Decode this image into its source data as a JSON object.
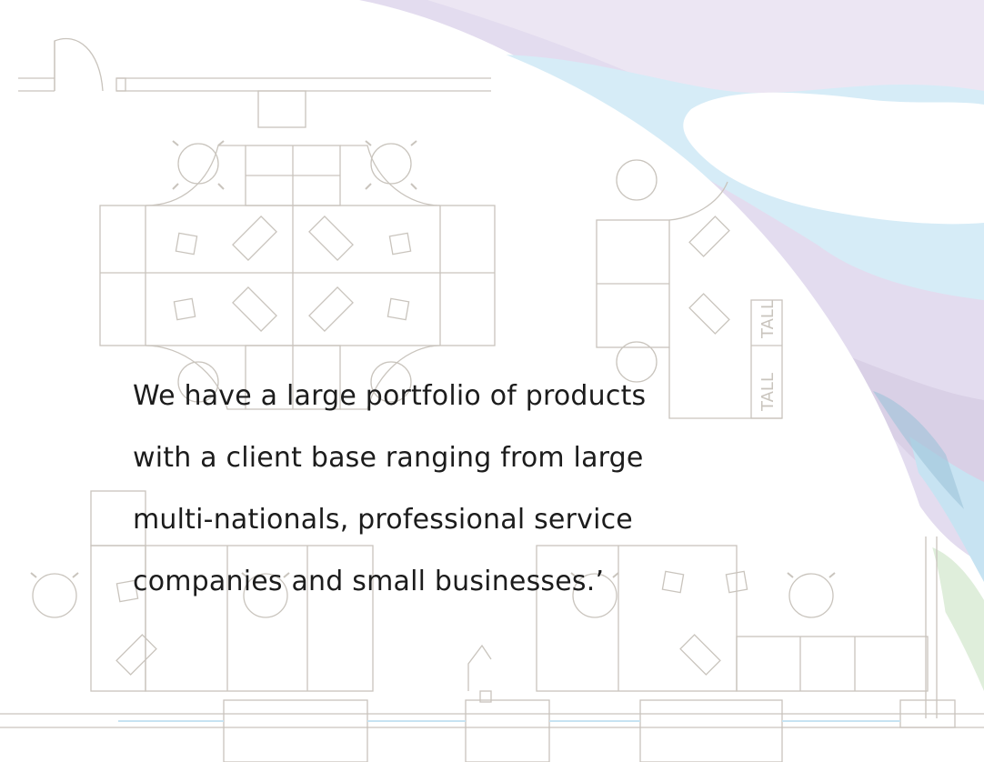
{
  "quote": {
    "lines": [
      "We have a large portfolio of products",
      "with a client base ranging from large",
      "multi-nationals, professional service",
      "companies and small businesses.’"
    ]
  },
  "floorplan": {
    "labels": [
      "TALL",
      "TALL"
    ]
  },
  "colors": {
    "floorplan_line": "#c9c4bd",
    "sky_light": "#dbeef8",
    "cloud": "#ffffff",
    "purple": "#e6dff0",
    "text": "#1c1c1c"
  }
}
